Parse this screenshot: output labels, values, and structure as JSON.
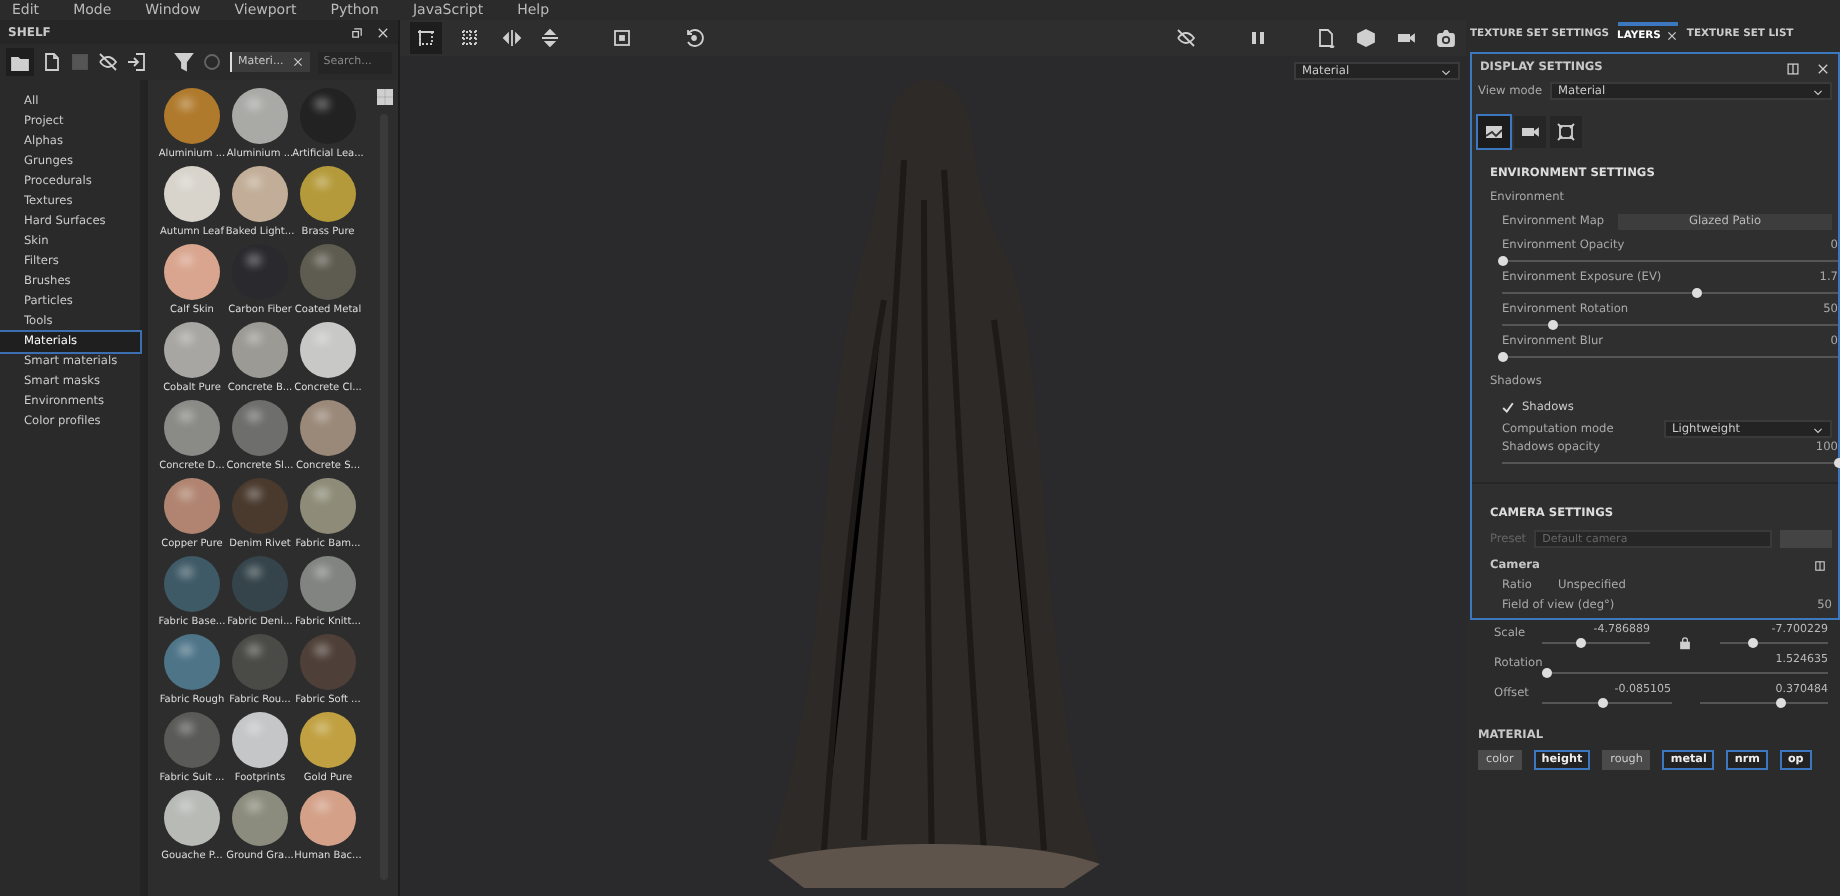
{
  "menu": [
    "Edit",
    "Mode",
    "Window",
    "Viewport",
    "Python",
    "JavaScript",
    "Help"
  ],
  "shelf": {
    "title": "SHELF",
    "filter_tag": "Materi...",
    "search": {
      "placeholder": "Search..."
    },
    "categories": [
      {
        "label": "All",
        "selected": false
      },
      {
        "label": "Project",
        "selected": false
      },
      {
        "label": "Alphas",
        "selected": false
      },
      {
        "label": "Grunges",
        "selected": false
      },
      {
        "label": "Procedurals",
        "selected": false
      },
      {
        "label": "Textures",
        "selected": false
      },
      {
        "label": "Hard Surfaces",
        "selected": false
      },
      {
        "label": "Skin",
        "selected": false
      },
      {
        "label": "Filters",
        "selected": false
      },
      {
        "label": "Brushes",
        "selected": false
      },
      {
        "label": "Particles",
        "selected": false
      },
      {
        "label": "Tools",
        "selected": false
      },
      {
        "label": "Materials",
        "selected": true
      },
      {
        "label": "Smart materials",
        "selected": false
      },
      {
        "label": "Smart masks",
        "selected": false
      },
      {
        "label": "Environments",
        "selected": false
      },
      {
        "label": "Color profiles",
        "selected": false
      }
    ],
    "materials": [
      {
        "name": "Aluminium ...",
        "color": "#b07a2c"
      },
      {
        "name": "Aluminium ...",
        "color": "#a9a9a6"
      },
      {
        "name": "Artificial Lea...",
        "color": "#222222"
      },
      {
        "name": "Autumn Leaf",
        "color": "#d8d4cc"
      },
      {
        "name": "Baked Light...",
        "color": "#c2ae98"
      },
      {
        "name": "Brass Pure",
        "color": "#b49a3a"
      },
      {
        "name": "Calf Skin",
        "color": "#d9a58e"
      },
      {
        "name": "Carbon Fiber",
        "color": "#2a2a2e"
      },
      {
        "name": "Coated Metal",
        "color": "#5e5c50"
      },
      {
        "name": "Cobalt Pure",
        "color": "#a8a6a2"
      },
      {
        "name": "Concrete B...",
        "color": "#9c9a94"
      },
      {
        "name": "Concrete Cl...",
        "color": "#c8c8c6"
      },
      {
        "name": "Concrete D...",
        "color": "#8a8a86"
      },
      {
        "name": "Concrete Sl...",
        "color": "#6e6e6c"
      },
      {
        "name": "Concrete S...",
        "color": "#9a8878"
      },
      {
        "name": "Copper Pure",
        "color": "#b08470"
      },
      {
        "name": "Denim Rivet",
        "color": "#4a3a2e"
      },
      {
        "name": "Fabric Bam...",
        "color": "#8e8c78"
      },
      {
        "name": "Fabric Base...",
        "color": "#3e5a66"
      },
      {
        "name": "Fabric Deni...",
        "color": "#34444a"
      },
      {
        "name": "Fabric Knitt...",
        "color": "#828482"
      },
      {
        "name": "Fabric Rough",
        "color": "#4e7488"
      },
      {
        "name": "Fabric Rou...",
        "color": "#4a4a46"
      },
      {
        "name": "Fabric Soft ...",
        "color": "#4e4038"
      },
      {
        "name": "Fabric Suit ...",
        "color": "#5a5a58"
      },
      {
        "name": "Footprints",
        "color": "#c4c6c8"
      },
      {
        "name": "Gold Pure",
        "color": "#c0a040"
      },
      {
        "name": "Gouache P...",
        "color": "#b8bab6"
      },
      {
        "name": "Ground Gra...",
        "color": "#8c8c7e"
      },
      {
        "name": "Human Bac...",
        "color": "#d4a088"
      }
    ]
  },
  "viewport": {
    "mode_dropdown": "Material"
  },
  "right_tabs": [
    {
      "label": "TEXTURE SET SETTINGS",
      "selected": false,
      "closable": false
    },
    {
      "label": "LAYERS",
      "selected": true,
      "closable": true
    },
    {
      "label": "TEXTURE SET LIST",
      "selected": false,
      "closable": false
    }
  ],
  "display_settings": {
    "title": "DISPLAY SETTINGS",
    "view_mode": {
      "label": "View mode",
      "value": "Material"
    },
    "icon_tabs": [
      {
        "kind": "environment",
        "selected": true
      },
      {
        "kind": "camera",
        "selected": false
      },
      {
        "kind": "frame",
        "selected": false
      }
    ],
    "environment": {
      "title": "ENVIRONMENT SETTINGS",
      "group": "Environment",
      "map": {
        "label": "Environment Map",
        "value": "Glazed Patio"
      },
      "sliders": [
        {
          "label": "Environment Opacity",
          "reading": "0",
          "level": 0
        },
        {
          "label": "Environment Exposure (EV)",
          "reading": "1.7",
          "level": 0.58
        },
        {
          "label": "Environment Rotation",
          "reading": "50",
          "level": 0.15
        },
        {
          "label": "Environment Blur",
          "reading": "0",
          "level": 0
        }
      ]
    },
    "shadows": {
      "group": "Shadows",
      "checkbox": {
        "label": "Shadows",
        "checked": true
      },
      "computation": {
        "label": "Computation mode",
        "value": "Lightweight"
      },
      "opacity": {
        "label": "Shadows opacity",
        "reading": "100",
        "level": 1
      }
    },
    "camera": {
      "title": "CAMERA SETTINGS",
      "preset": {
        "label": "Preset",
        "placeholder": "Default camera"
      },
      "group": "Camera",
      "ratio": {
        "label": "Ratio",
        "value": "Unspecified"
      },
      "fov": {
        "label": "Field of view (deg°)",
        "reading": "50"
      }
    }
  },
  "transform": [
    {
      "label": "Scale",
      "sliders": [
        {
          "reading": "-4.786889",
          "level": 0.37
        },
        {
          "reading": "-7.700229",
          "level": 0.31
        }
      ]
    },
    {
      "label": "Rotation",
      "sliders": [
        {
          "reading": "1.524635",
          "level": 0.02
        }
      ]
    },
    {
      "label": "Offset",
      "sliders": [
        {
          "reading": "-0.085105",
          "level": 0.47
        },
        {
          "reading": "0.370484",
          "level": 0.63
        }
      ]
    }
  ],
  "material": {
    "title": "MATERIAL",
    "channels": [
      {
        "label": "color",
        "on": false
      },
      {
        "label": "height",
        "on": true
      },
      {
        "label": "rough",
        "on": false
      },
      {
        "label": "metal",
        "on": true
      },
      {
        "label": "nrm",
        "on": true
      },
      {
        "label": "op",
        "on": true
      }
    ]
  }
}
